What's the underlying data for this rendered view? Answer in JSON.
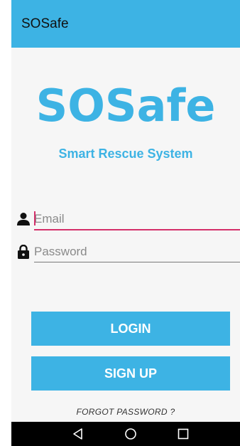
{
  "colors": {
    "accent": "#3db3e4",
    "focus_underline": "#d4306a",
    "nav_bar": "#000000"
  },
  "app_bar": {
    "title": "SOSafe"
  },
  "branding": {
    "logo_text": "SOSafe",
    "tagline": "Smart Rescue System"
  },
  "form": {
    "email": {
      "icon": "person-icon",
      "placeholder": "Email",
      "value": "",
      "focused": true
    },
    "password": {
      "icon": "lock-icon",
      "placeholder": "Password",
      "value": ""
    }
  },
  "buttons": {
    "login_label": "LOGIN",
    "signup_label": "SIGN UP"
  },
  "links": {
    "forgot_password": "FORGOT PASSWORD ?"
  },
  "system_nav": {
    "back": "back-triangle-icon",
    "home": "home-circle-icon",
    "recents": "recents-square-icon"
  }
}
